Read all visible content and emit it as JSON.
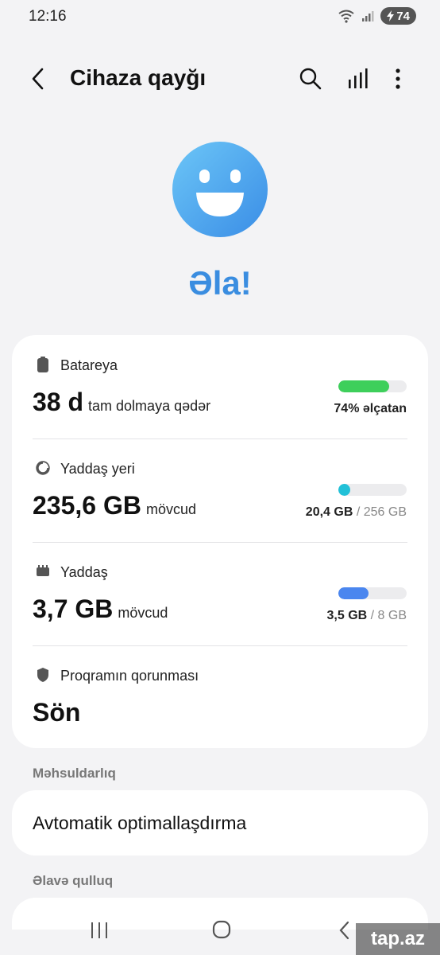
{
  "status_bar": {
    "time": "12:16",
    "battery": "74"
  },
  "header": {
    "title": "Cihaza qayğı"
  },
  "hero": {
    "status": "Əla!",
    "face_color": "#4aa6ef"
  },
  "battery": {
    "label": "Batareya",
    "value": "38 d",
    "unit": "tam dolmaya qədər",
    "caption": "74% əlçatan",
    "level": 0.74,
    "color": "#3ecf5b"
  },
  "storage": {
    "label": "Yaddaş yeri",
    "value": "235,6 GB",
    "unit": "mövcud",
    "used": "20,4 GB",
    "total": "/ 256 GB",
    "level": 0.08,
    "color": "#22c1d8"
  },
  "memory": {
    "label": "Yaddaş",
    "value": "3,7 GB",
    "unit": "mövcud",
    "used": "3,5 GB",
    "total": "/ 8 GB",
    "level": 0.44,
    "color": "#4a86ef"
  },
  "protection": {
    "label": "Proqramın qorunması",
    "value": "Sön"
  },
  "performance": {
    "section": "Məhsuldarlıq",
    "auto_opt": "Avtomatik optimallaşdırma"
  },
  "extra": {
    "section": "Əlavə qulluq"
  },
  "watermark": "tap.az"
}
